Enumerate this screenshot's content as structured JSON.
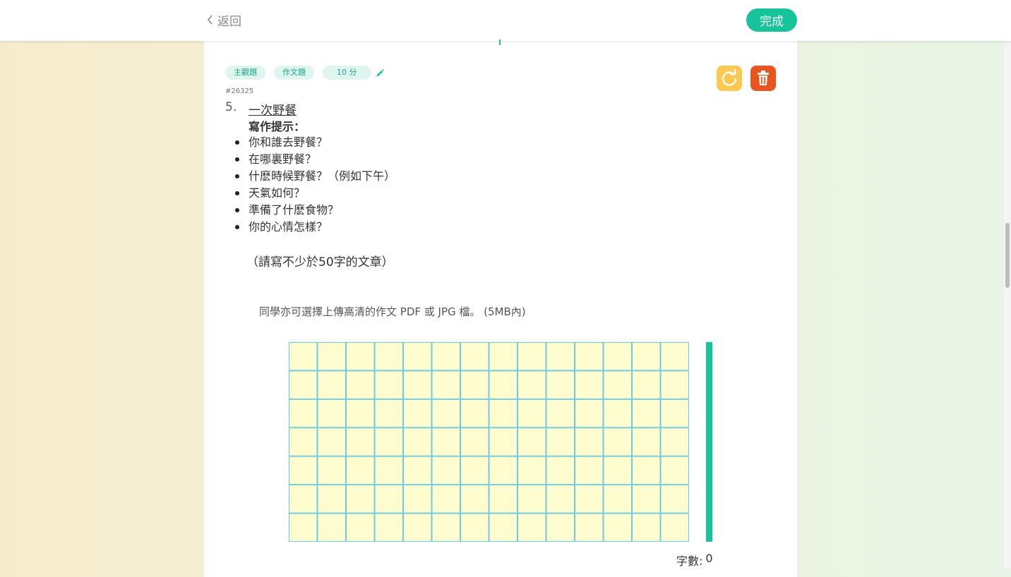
{
  "nav": {
    "back_label": "返回",
    "done_label": "完成"
  },
  "question": {
    "tags": [
      "主觀題",
      "作文題"
    ],
    "duration_label": "10 分",
    "id_label": "#26325",
    "number": "5.",
    "title": "一次野餐",
    "hint_heading": "寫作提示：",
    "hints": [
      "你和誰去野餐？",
      "在哪裏野餐？",
      "什麽時候野餐？（例如下午）",
      "天氣如何？",
      "準備了什麽食物？",
      "你的心情怎樣？"
    ],
    "requirement": "（請寫不少於50字的文章）",
    "upload_note": "同學亦可選擇上傳高清的作文 PDF 或 JPG 檔。 (5MB內)"
  },
  "grid": {
    "columns": 14,
    "rows": 7,
    "fill_color": "#fffcd0",
    "line_color": "#6ccbe0"
  },
  "word_count": {
    "label": "字數:",
    "value": "0"
  },
  "colors": {
    "accent": "#17c39b",
    "refresh": "#fbc94f",
    "delete": "#e9541f"
  },
  "icons": {
    "back": "chevron-left-icon",
    "edit": "pencil-icon",
    "refresh": "refresh-icon",
    "delete": "trash-icon"
  }
}
